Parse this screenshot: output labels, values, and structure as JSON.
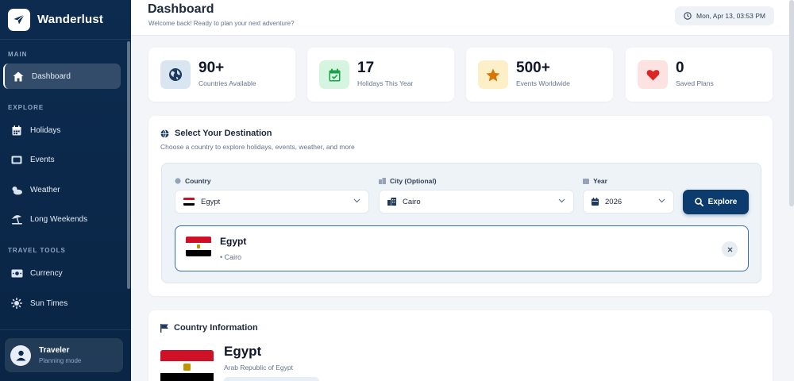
{
  "app": {
    "name": "Wanderlust"
  },
  "sidebar": {
    "sections": [
      {
        "label": "MAIN"
      },
      {
        "label": "EXPLORE"
      },
      {
        "label": "TRAVEL TOOLS"
      }
    ],
    "items": [
      {
        "label": "Dashboard",
        "icon": "home-icon",
        "active": true
      },
      {
        "label": "Holidays",
        "icon": "calendar-icon"
      },
      {
        "label": "Events",
        "icon": "ticket-icon"
      },
      {
        "label": "Weather",
        "icon": "cloud-sun-icon"
      },
      {
        "label": "Long Weekends",
        "icon": "umbrella-beach-icon"
      },
      {
        "label": "Currency",
        "icon": "money-icon"
      },
      {
        "label": "Sun Times",
        "icon": "sun-icon"
      }
    ],
    "user": {
      "name": "Traveler",
      "mode": "Planning mode"
    }
  },
  "header": {
    "title": "Dashboard",
    "subtitle": "Welcome back! Ready to plan your next adventure?",
    "datetime": "Mon, Apr 13, 03:53 PM"
  },
  "stats": [
    {
      "value": "90+",
      "label": "Countries Available",
      "icon": "globe-icon",
      "color": "#1e3a5f",
      "bg": "#d9e5f1"
    },
    {
      "value": "17",
      "label": "Holidays This Year",
      "icon": "calendar-check-icon",
      "color": "#16a34a",
      "bg": "#d5f5e1"
    },
    {
      "value": "500+",
      "label": "Events Worldwide",
      "icon": "star-icon",
      "color": "#d97706",
      "bg": "#fdf0c8"
    },
    {
      "value": "0",
      "label": "Saved Plans",
      "icon": "heart-icon",
      "color": "#dc2626",
      "bg": "#fde2e2"
    }
  ],
  "destination": {
    "title": "Select Your Destination",
    "subtitle": "Choose a country to explore holidays, events, weather, and more",
    "country_label": "Country",
    "country_value": "Egypt",
    "city_label": "City (Optional)",
    "city_value": "Cairo",
    "year_label": "Year",
    "year_value": "2026",
    "explore_label": "Explore",
    "selected": {
      "name": "Egypt",
      "city": "• Cairo"
    }
  },
  "country_info": {
    "title": "Country Information",
    "name": "Egypt",
    "official_name": "Arab Republic of Egypt"
  }
}
